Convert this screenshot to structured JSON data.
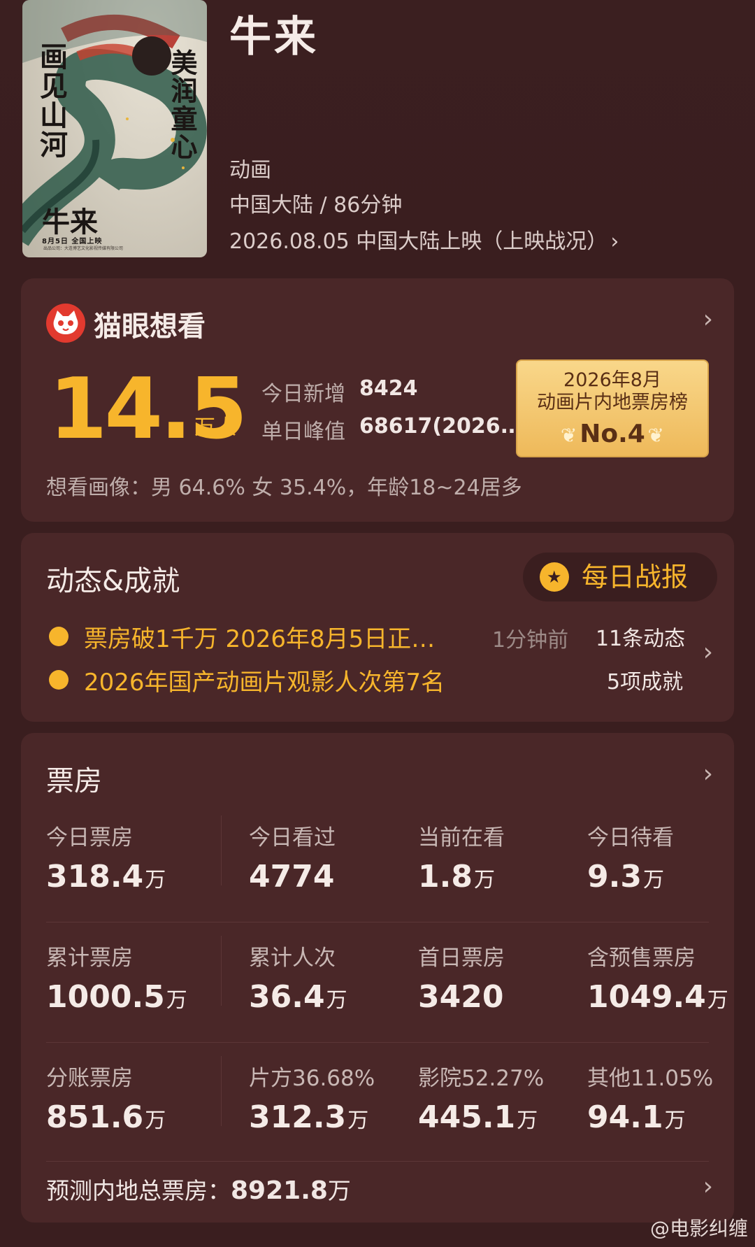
{
  "movie": {
    "title": "牛来",
    "genre": "动画",
    "region_duration": "中国大陆 / 86分钟",
    "release": "2026.08.05 中国大陆上映（上映战况）",
    "poster": {
      "left_tag": "画见山河",
      "right_tag": "美润童心",
      "title": "牛来",
      "date": "8月5日 全国上映",
      "credits": "出品公司：大连博艺文化影视传媒有限公司"
    }
  },
  "maoyan": {
    "heading": "猫眼想看",
    "count": "14.5",
    "count_unit": "万人",
    "new_today_label": "今日新增",
    "new_today_value": "8424",
    "peak_label": "单日峰值",
    "peak_value": "68617(2026.…",
    "badge": {
      "line1": "2026年8月",
      "line2": "动画片内地票房榜",
      "rank": "No.4"
    },
    "persona": "想看画像：男 64.6%  女 35.4%，年龄18~24居多"
  },
  "dynamics": {
    "heading": "动态&成就",
    "daily_report": "每日战报",
    "items": [
      {
        "text": "票房破1千万 2026年8月5日正…",
        "time": "1分钟前",
        "count": "11条动态"
      },
      {
        "text": "2026年国产动画片观影人次第7名",
        "count": "5项成就"
      }
    ]
  },
  "boxoffice": {
    "heading": "票房",
    "rows": [
      [
        {
          "label": "今日票房",
          "value": "318.4",
          "unit": "万"
        },
        {
          "label": "今日看过",
          "value": "4774",
          "unit": ""
        },
        {
          "label": "当前在看",
          "value": "1.8",
          "unit": "万"
        },
        {
          "label": "今日待看",
          "value": "9.3",
          "unit": "万"
        }
      ],
      [
        {
          "label": "累计票房",
          "value": "1000.5",
          "unit": "万"
        },
        {
          "label": "累计人次",
          "value": "36.4",
          "unit": "万"
        },
        {
          "label": "首日票房",
          "value": "3420",
          "unit": ""
        },
        {
          "label": "含预售票房",
          "value": "1049.4",
          "unit": "万"
        }
      ],
      [
        {
          "label": "分账票房",
          "value": "851.6",
          "unit": "万"
        },
        {
          "label": "片方36.68%",
          "value": "312.3",
          "unit": "万"
        },
        {
          "label": "影院52.27%",
          "value": "445.1",
          "unit": "万"
        },
        {
          "label": "其他11.05%",
          "value": "94.1",
          "unit": "万"
        }
      ]
    ],
    "forecast_label": "预测内地总票房：",
    "forecast_value": "8921.8",
    "forecast_unit": "万"
  },
  "watermark": "@电影纠缠",
  "colors": {
    "accent": "#f7b52c",
    "background": "#3a1e1f",
    "card": "#4a2728"
  }
}
